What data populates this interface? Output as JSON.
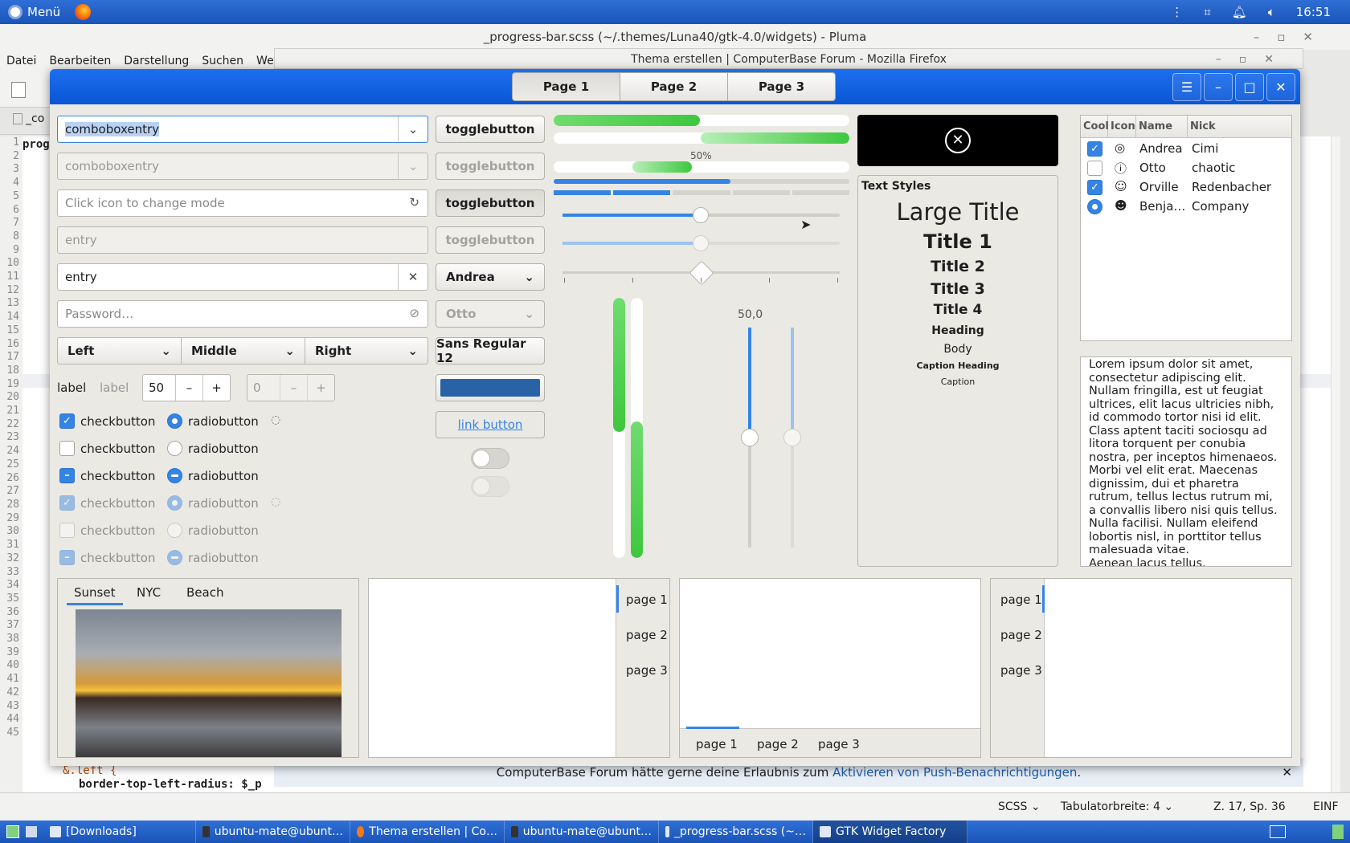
{
  "top_panel": {
    "menu_label": "Menü",
    "clock": "16:51"
  },
  "pluma": {
    "title": "_progress-bar.scss (~/.themes/Luna40/gtk-4.0/widgets) - Pluma",
    "menus": [
      "Datei",
      "Bearbeiten",
      "Darstellung",
      "Suchen",
      "Werk"
    ],
    "tab_label": "_co",
    "line_numbers": [
      "1",
      "2",
      "3",
      "4",
      "5",
      "6",
      "7",
      "8",
      "9",
      "10",
      "11",
      "12",
      "13",
      "14",
      "15",
      "16",
      "17",
      "18",
      "19",
      "20",
      "21",
      "22",
      "23",
      "24",
      "25",
      "26",
      "27",
      "28",
      "29",
      "30",
      "31",
      "32",
      "33",
      "34",
      "35",
      "36",
      "37",
      "38",
      "39",
      "40",
      "41",
      "42",
      "43",
      "44",
      "45"
    ],
    "code_first": "prog",
    "code_bottom_1": "&.left {",
    "code_bottom_2": "border-top-left-radius: $_p",
    "status": {
      "language": "SCSS",
      "tab_width": "Tabulatorbreite:  4",
      "position": "Z. 17, Sp. 36",
      "mode": "EINF"
    }
  },
  "firefox": {
    "title": "Thema erstellen | ComputerBase Forum - Mozilla Firefox",
    "notification_prefix": "ComputerBase Forum hätte gerne deine Erlaubnis zum ",
    "notification_link": "Aktivieren von Push-Benachrichtigungen",
    "notification_suffix": "."
  },
  "gtk": {
    "pages": [
      "Page 1",
      "Page 2",
      "Page 3"
    ],
    "combo1": "comboboxentry",
    "combo2": "comboboxentry",
    "mode_entry_placeholder": "Click icon to change mode",
    "entry_disabled": "entry",
    "entry_clear": "entry",
    "password_placeholder": "Password…",
    "segments": [
      "Left",
      "Middle",
      "Right"
    ],
    "label1": "label",
    "label2": "label",
    "spin1": "50",
    "spin2": "0",
    "check_label": "checkbutton",
    "radio_label": "radiobutton",
    "toggle_label": "togglebutton",
    "combo_andrea": "Andrea",
    "combo_otto": "Otto",
    "font_button": "Sans Regular  12",
    "link_button": "link button",
    "accent_color": "#3584e4",
    "progress_label": "50%",
    "scale_value": "50,0",
    "text_styles": {
      "header": "Text Styles",
      "large_title": "Large Title",
      "title1": "Title 1",
      "title2": "Title 2",
      "title3": "Title 3",
      "title4": "Title 4",
      "heading": "Heading",
      "body": "Body",
      "caption_heading": "Caption Heading",
      "caption": "Caption"
    },
    "tree": {
      "columns": [
        "Cool",
        "Icon",
        "Name",
        "Nick"
      ],
      "rows": [
        {
          "name": "Andrea",
          "nick": "Cimi",
          "icon": "check-circle-icon"
        },
        {
          "name": "Otto",
          "nick": "chaotic",
          "icon": "warning-circle-icon"
        },
        {
          "name": "Orville",
          "nick": "Redenbacher",
          "icon": "smile-icon"
        },
        {
          "name": "Benja…",
          "nick": "Company",
          "icon": "face-icon"
        }
      ]
    },
    "lorem": "Lorem ipsum dolor sit amet, consectetur adipiscing elit.\nNullam fringilla, est ut feugiat ultrices, elit lacus ultricies nibh, id commodo tortor nisi id elit.\nClass aptent taciti sociosqu ad litora torquent per conubia nostra, per inceptos himenaeos.\nMorbi vel elit erat. Maecenas dignissim, dui et pharetra rutrum, tellus lectus rutrum mi, a convallis libero nisi quis tellus.\nNulla facilisi. Nullam eleifend lobortis nisl, in porttitor tellus malesuada vitae.\nAenean lacus tellus, pellentesque",
    "photo_tabs": [
      "Sunset",
      "NYC",
      "Beach"
    ],
    "nb_pages": [
      "page 1",
      "page 2",
      "page 3"
    ]
  },
  "taskbar": {
    "items": [
      "[Downloads]",
      "ubuntu-mate@ubunt…",
      "Thema erstellen | Co…",
      "ubuntu-mate@ubunt…",
      "_progress-bar.scss (~…",
      "GTK Widget Factory"
    ]
  }
}
